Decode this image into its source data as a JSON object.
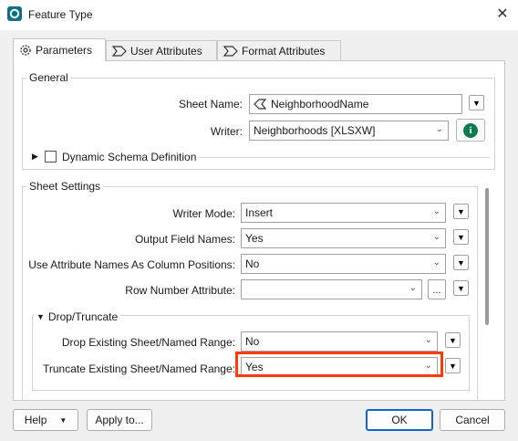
{
  "window": {
    "title": "Feature Type",
    "close_glyph": "✕"
  },
  "tabs": [
    {
      "label": "Parameters",
      "icon": "gear-icon"
    },
    {
      "label": "User Attributes",
      "icon": "chevron-tag-icon"
    },
    {
      "label": "Format Attributes",
      "icon": "chevron-tag-icon"
    }
  ],
  "general": {
    "title": "General",
    "sheet_name_label": "Sheet Name:",
    "sheet_name_value": "NeighborhoodName",
    "writer_label": "Writer:",
    "writer_value": "Neighborhoods [XLSXW]",
    "info_glyph": "i",
    "dynamic_schema_label": "Dynamic Schema Definition"
  },
  "sheet_settings": {
    "title": "Sheet Settings",
    "writer_mode_label": "Writer Mode:",
    "writer_mode_value": "Insert",
    "output_field_names_label": "Output Field Names:",
    "output_field_names_value": "Yes",
    "use_attr_names_label": "Use Attribute Names As Column Positions:",
    "use_attr_names_value": "No",
    "row_number_label": "Row Number Attribute:",
    "row_number_value": "",
    "ellipsis_label": "...",
    "drop_truncate": {
      "title": "Drop/Truncate",
      "drop_label": "Drop Existing Sheet/Named Range:",
      "drop_value": "No",
      "truncate_label": "Truncate Existing Sheet/Named Range:",
      "truncate_value": "Yes"
    }
  },
  "footer": {
    "help_label": "Help",
    "apply_label": "Apply to...",
    "ok_label": "OK",
    "cancel_label": "Cancel"
  },
  "colors": {
    "highlight": "#ff3b00",
    "accent": "#0f64c8",
    "app_icon": "#0d6f86"
  }
}
